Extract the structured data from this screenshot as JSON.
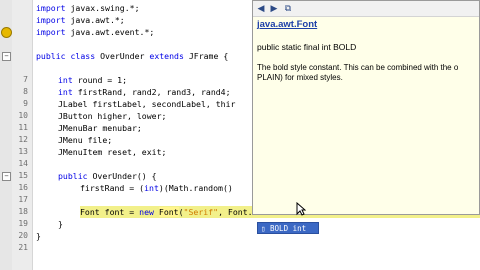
{
  "editor": {
    "line_numbers": [
      "",
      "",
      "",
      "",
      "",
      "",
      "7",
      "8",
      "9",
      "10",
      "11",
      "12",
      "13",
      "14",
      "15",
      "16",
      "17",
      "18",
      "19",
      "20",
      "21"
    ],
    "lines": [
      {
        "indent": 0,
        "parts": [
          [
            "kw",
            "import"
          ],
          [
            "t",
            " javax.swing.*;"
          ]
        ]
      },
      {
        "indent": 0,
        "parts": [
          [
            "kw",
            "import"
          ],
          [
            "t",
            " java.awt.*;"
          ]
        ]
      },
      {
        "indent": 0,
        "parts": [
          [
            "kw",
            "import"
          ],
          [
            "t",
            " java.awt.event.*;"
          ]
        ]
      },
      {
        "indent": 0,
        "parts": [
          [
            "t",
            ""
          ]
        ]
      },
      {
        "indent": 0,
        "parts": [
          [
            "kw",
            "public class"
          ],
          [
            "t",
            " OverUnder "
          ],
          [
            "kw",
            "extends"
          ],
          [
            "t",
            " JFrame {"
          ]
        ]
      },
      {
        "indent": 0,
        "parts": [
          [
            "t",
            ""
          ]
        ]
      },
      {
        "indent": 1,
        "parts": [
          [
            "kw",
            "int"
          ],
          [
            "t",
            " round = 1;"
          ]
        ]
      },
      {
        "indent": 1,
        "parts": [
          [
            "kw",
            "int"
          ],
          [
            "t",
            " firstRand, rand2, rand3, rand4;"
          ]
        ]
      },
      {
        "indent": 1,
        "parts": [
          [
            "t",
            "JLabel firstLabel, secondLabel, thir"
          ]
        ]
      },
      {
        "indent": 1,
        "parts": [
          [
            "t",
            "JButton higher, lower;"
          ]
        ]
      },
      {
        "indent": 1,
        "parts": [
          [
            "t",
            "JMenuBar menubar;"
          ]
        ]
      },
      {
        "indent": 1,
        "parts": [
          [
            "t",
            "JMenu file;"
          ]
        ]
      },
      {
        "indent": 1,
        "parts": [
          [
            "t",
            "JMenuItem reset, exit;"
          ]
        ]
      },
      {
        "indent": 0,
        "parts": [
          [
            "t",
            ""
          ]
        ]
      },
      {
        "indent": 1,
        "parts": [
          [
            "kw",
            "public"
          ],
          [
            "t",
            " OverUnder() {"
          ]
        ]
      },
      {
        "indent": 2,
        "parts": [
          [
            "t",
            "firstRand = ("
          ],
          [
            "kw",
            "int"
          ],
          [
            "t",
            ")(Math.random()"
          ]
        ]
      },
      {
        "indent": 0,
        "parts": [
          [
            "t",
            ""
          ]
        ]
      },
      {
        "indent": 2,
        "parts": [
          [
            "t",
            "Font font = "
          ],
          [
            "kw",
            "new"
          ],
          [
            "t",
            " "
          ],
          [
            "hi",
            "Font"
          ],
          [
            "t",
            "("
          ],
          [
            "str",
            "\"Serif\""
          ],
          [
            "t",
            ", Font.BOLD"
          ]
        ]
      },
      {
        "indent": 1,
        "parts": [
          [
            "t",
            "}"
          ]
        ]
      },
      {
        "indent": 0,
        "parts": [
          [
            "t",
            "}"
          ]
        ]
      },
      {
        "indent": 0,
        "parts": [
          [
            "t",
            ""
          ]
        ]
      }
    ]
  },
  "javadoc": {
    "title": "java.awt.Font",
    "signature": "public static final int BOLD",
    "description": "The bold style constant. This can be combined with the o PLAIN) for mixed styles."
  },
  "completion": {
    "item": "BOLD int"
  }
}
